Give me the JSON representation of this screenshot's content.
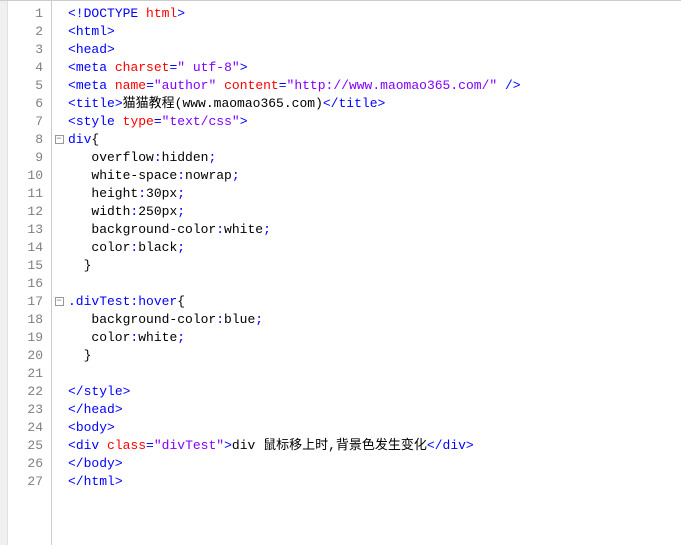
{
  "lines": [
    {
      "n": 1,
      "fold": "",
      "tokens": [
        {
          "c": "t-punct",
          "t": "<!"
        },
        {
          "c": "t-tag",
          "t": "DOCTYPE"
        },
        {
          "c": "t-text",
          "t": " "
        },
        {
          "c": "t-attr",
          "t": "html"
        },
        {
          "c": "t-punct",
          "t": ">"
        }
      ]
    },
    {
      "n": 2,
      "fold": "",
      "tokens": [
        {
          "c": "t-punct",
          "t": "<"
        },
        {
          "c": "t-tag",
          "t": "html"
        },
        {
          "c": "t-punct",
          "t": ">"
        }
      ]
    },
    {
      "n": 3,
      "fold": "",
      "tokens": [
        {
          "c": "t-punct",
          "t": "<"
        },
        {
          "c": "t-tag",
          "t": "head"
        },
        {
          "c": "t-punct",
          "t": ">"
        }
      ]
    },
    {
      "n": 4,
      "fold": "",
      "tokens": [
        {
          "c": "t-punct",
          "t": "<"
        },
        {
          "c": "t-tag",
          "t": "meta"
        },
        {
          "c": "t-text",
          "t": " "
        },
        {
          "c": "t-attr",
          "t": "charset"
        },
        {
          "c": "t-punct",
          "t": "="
        },
        {
          "c": "t-str",
          "t": "\" utf-8\""
        },
        {
          "c": "t-punct",
          "t": ">"
        }
      ]
    },
    {
      "n": 5,
      "fold": "",
      "tokens": [
        {
          "c": "t-punct",
          "t": "<"
        },
        {
          "c": "t-tag",
          "t": "meta"
        },
        {
          "c": "t-text",
          "t": " "
        },
        {
          "c": "t-attr",
          "t": "name"
        },
        {
          "c": "t-punct",
          "t": "="
        },
        {
          "c": "t-str",
          "t": "\"author\""
        },
        {
          "c": "t-text",
          "t": " "
        },
        {
          "c": "t-attr",
          "t": "content"
        },
        {
          "c": "t-punct",
          "t": "="
        },
        {
          "c": "t-str",
          "t": "\"http://www.maomao365.com/\""
        },
        {
          "c": "t-text",
          "t": " "
        },
        {
          "c": "t-punct",
          "t": "/>"
        }
      ]
    },
    {
      "n": 6,
      "fold": "",
      "tokens": [
        {
          "c": "t-punct",
          "t": "<"
        },
        {
          "c": "t-tag",
          "t": "title"
        },
        {
          "c": "t-punct",
          "t": ">"
        },
        {
          "c": "t-text",
          "t": "猫猫教程(www.maomao365.com)"
        },
        {
          "c": "t-punct",
          "t": "</"
        },
        {
          "c": "t-tag",
          "t": "title"
        },
        {
          "c": "t-punct",
          "t": ">"
        }
      ]
    },
    {
      "n": 7,
      "fold": "",
      "tokens": [
        {
          "c": "t-punct",
          "t": "<"
        },
        {
          "c": "t-tag",
          "t": "style"
        },
        {
          "c": "t-text",
          "t": " "
        },
        {
          "c": "t-attr",
          "t": "type"
        },
        {
          "c": "t-punct",
          "t": "="
        },
        {
          "c": "t-str",
          "t": "\"text/css\""
        },
        {
          "c": "t-punct",
          "t": ">"
        }
      ]
    },
    {
      "n": 8,
      "fold": "box",
      "tokens": [
        {
          "c": "t-sel",
          "t": "div"
        },
        {
          "c": "t-brace",
          "t": "{"
        }
      ]
    },
    {
      "n": 9,
      "fold": "",
      "indent": "   ",
      "tokens": [
        {
          "c": "t-prop",
          "t": "overflow"
        },
        {
          "c": "t-punct",
          "t": ":"
        },
        {
          "c": "t-val",
          "t": "hidden"
        },
        {
          "c": "t-punct",
          "t": ";"
        }
      ]
    },
    {
      "n": 10,
      "fold": "",
      "indent": "   ",
      "tokens": [
        {
          "c": "t-prop",
          "t": "white-space"
        },
        {
          "c": "t-punct",
          "t": ":"
        },
        {
          "c": "t-val",
          "t": "nowrap"
        },
        {
          "c": "t-punct",
          "t": ";"
        }
      ]
    },
    {
      "n": 11,
      "fold": "",
      "indent": "   ",
      "tokens": [
        {
          "c": "t-prop",
          "t": "height"
        },
        {
          "c": "t-punct",
          "t": ":"
        },
        {
          "c": "t-val",
          "t": "30px"
        },
        {
          "c": "t-punct",
          "t": ";"
        }
      ]
    },
    {
      "n": 12,
      "fold": "",
      "indent": "   ",
      "tokens": [
        {
          "c": "t-prop",
          "t": "width"
        },
        {
          "c": "t-punct",
          "t": ":"
        },
        {
          "c": "t-val",
          "t": "250px"
        },
        {
          "c": "t-punct",
          "t": ";"
        }
      ]
    },
    {
      "n": 13,
      "fold": "",
      "indent": "   ",
      "tokens": [
        {
          "c": "t-prop",
          "t": "background-color"
        },
        {
          "c": "t-punct",
          "t": ":"
        },
        {
          "c": "t-val",
          "t": "white"
        },
        {
          "c": "t-punct",
          "t": ";"
        }
      ]
    },
    {
      "n": 14,
      "fold": "",
      "indent": "   ",
      "tokens": [
        {
          "c": "t-prop",
          "t": "color"
        },
        {
          "c": "t-punct",
          "t": ":"
        },
        {
          "c": "t-val",
          "t": "black"
        },
        {
          "c": "t-punct",
          "t": ";"
        }
      ]
    },
    {
      "n": 15,
      "fold": "",
      "indent": "  ",
      "tokens": [
        {
          "c": "t-brace",
          "t": "}"
        }
      ]
    },
    {
      "n": 16,
      "fold": "",
      "tokens": []
    },
    {
      "n": 17,
      "fold": "box",
      "tokens": [
        {
          "c": "t-sel",
          "t": ".divTest:hover"
        },
        {
          "c": "t-brace",
          "t": "{"
        }
      ]
    },
    {
      "n": 18,
      "fold": "",
      "indent": "   ",
      "tokens": [
        {
          "c": "t-prop",
          "t": "background-color"
        },
        {
          "c": "t-punct",
          "t": ":"
        },
        {
          "c": "t-val",
          "t": "blue"
        },
        {
          "c": "t-punct",
          "t": ";"
        }
      ]
    },
    {
      "n": 19,
      "fold": "",
      "indent": "   ",
      "tokens": [
        {
          "c": "t-prop",
          "t": "color"
        },
        {
          "c": "t-punct",
          "t": ":"
        },
        {
          "c": "t-val",
          "t": "white"
        },
        {
          "c": "t-punct",
          "t": ";"
        }
      ]
    },
    {
      "n": 20,
      "fold": "",
      "indent": "  ",
      "tokens": [
        {
          "c": "t-brace",
          "t": "}"
        }
      ]
    },
    {
      "n": 21,
      "fold": "",
      "tokens": []
    },
    {
      "n": 22,
      "fold": "",
      "tokens": [
        {
          "c": "t-punct",
          "t": "</"
        },
        {
          "c": "t-tag",
          "t": "style"
        },
        {
          "c": "t-punct",
          "t": ">"
        }
      ]
    },
    {
      "n": 23,
      "fold": "",
      "tokens": [
        {
          "c": "t-punct",
          "t": "</"
        },
        {
          "c": "t-tag",
          "t": "head"
        },
        {
          "c": "t-punct",
          "t": ">"
        }
      ]
    },
    {
      "n": 24,
      "fold": "",
      "tokens": [
        {
          "c": "t-punct",
          "t": "<"
        },
        {
          "c": "t-tag",
          "t": "body"
        },
        {
          "c": "t-punct",
          "t": ">"
        }
      ]
    },
    {
      "n": 25,
      "fold": "",
      "tokens": [
        {
          "c": "t-punct",
          "t": "<"
        },
        {
          "c": "t-tag",
          "t": "div"
        },
        {
          "c": "t-text",
          "t": " "
        },
        {
          "c": "t-attr",
          "t": "class"
        },
        {
          "c": "t-punct",
          "t": "="
        },
        {
          "c": "t-str",
          "t": "\"divTest\""
        },
        {
          "c": "t-punct",
          "t": ">"
        },
        {
          "c": "t-text",
          "t": "div 鼠标移上时,背景色发生变化"
        },
        {
          "c": "t-punct",
          "t": "</"
        },
        {
          "c": "t-tag",
          "t": "div"
        },
        {
          "c": "t-punct",
          "t": ">"
        }
      ]
    },
    {
      "n": 26,
      "fold": "",
      "tokens": [
        {
          "c": "t-punct",
          "t": "</"
        },
        {
          "c": "t-tag",
          "t": "body"
        },
        {
          "c": "t-punct",
          "t": ">"
        }
      ]
    },
    {
      "n": 27,
      "fold": "",
      "tokens": [
        {
          "c": "t-punct",
          "t": "</"
        },
        {
          "c": "t-tag",
          "t": "html"
        },
        {
          "c": "t-punct",
          "t": ">"
        }
      ]
    }
  ],
  "fold_glyph": "−"
}
